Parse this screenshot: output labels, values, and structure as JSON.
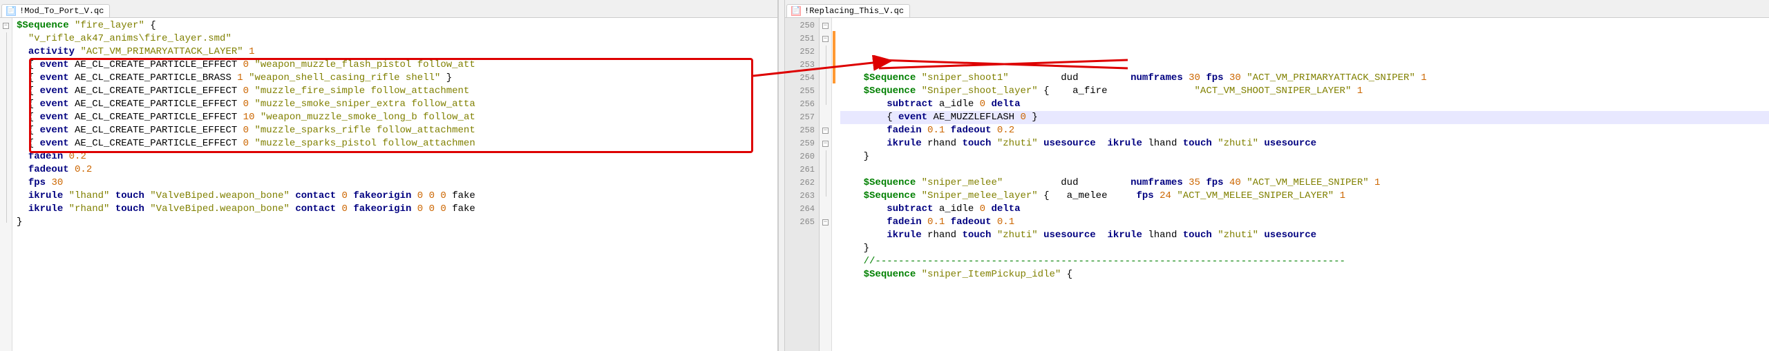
{
  "leftTab": {
    "filename": "!Mod_To_Port_V.qc"
  },
  "rightTab": {
    "filename": "!Replacing_This_V.qc"
  },
  "leftLines": [
    {
      "tokens": [
        {
          "cls": "seq",
          "t": "$Sequence"
        },
        {
          "cls": "op",
          "t": " "
        },
        {
          "cls": "str",
          "t": "\"fire_layer\""
        },
        {
          "cls": "op",
          "t": " {"
        }
      ]
    },
    {
      "tokens": [
        {
          "cls": "op",
          "t": "  "
        },
        {
          "cls": "str",
          "t": "\"v_rifle_ak47_anims\\fire_layer.smd\""
        }
      ]
    },
    {
      "tokens": [
        {
          "cls": "op",
          "t": "  "
        },
        {
          "cls": "kw-dark",
          "t": "activity"
        },
        {
          "cls": "op",
          "t": " "
        },
        {
          "cls": "str",
          "t": "\"ACT_VM_PRIMARYATTACK_LAYER\""
        },
        {
          "cls": "op",
          "t": " "
        },
        {
          "cls": "num",
          "t": "1"
        }
      ]
    },
    {
      "tokens": [
        {
          "cls": "op",
          "t": "  { "
        },
        {
          "cls": "kw-dark",
          "t": "event"
        },
        {
          "cls": "op",
          "t": " AE_CL_CREATE_PARTICLE_EFFECT "
        },
        {
          "cls": "num",
          "t": "0"
        },
        {
          "cls": "op",
          "t": " "
        },
        {
          "cls": "str",
          "t": "\"weapon_muzzle_flash_pistol follow_att"
        }
      ]
    },
    {
      "tokens": [
        {
          "cls": "op",
          "t": "  { "
        },
        {
          "cls": "kw-dark",
          "t": "event"
        },
        {
          "cls": "op",
          "t": " AE_CL_CREATE_PARTICLE_BRASS "
        },
        {
          "cls": "num",
          "t": "1"
        },
        {
          "cls": "op",
          "t": " "
        },
        {
          "cls": "str",
          "t": "\"weapon_shell_casing_rifle shell\""
        },
        {
          "cls": "op",
          "t": " }"
        }
      ]
    },
    {
      "tokens": [
        {
          "cls": "op",
          "t": "  { "
        },
        {
          "cls": "kw-dark",
          "t": "event"
        },
        {
          "cls": "op",
          "t": " AE_CL_CREATE_PARTICLE_EFFECT "
        },
        {
          "cls": "num",
          "t": "0"
        },
        {
          "cls": "op",
          "t": " "
        },
        {
          "cls": "str",
          "t": "\"muzzle_fire_simple follow_attachment"
        }
      ]
    },
    {
      "tokens": [
        {
          "cls": "op",
          "t": "  { "
        },
        {
          "cls": "kw-dark",
          "t": "event"
        },
        {
          "cls": "op",
          "t": " AE_CL_CREATE_PARTICLE_EFFECT "
        },
        {
          "cls": "num",
          "t": "0"
        },
        {
          "cls": "op",
          "t": " "
        },
        {
          "cls": "str",
          "t": "\"muzzle_smoke_sniper_extra follow_atta"
        }
      ]
    },
    {
      "tokens": [
        {
          "cls": "op",
          "t": "  { "
        },
        {
          "cls": "kw-dark",
          "t": "event"
        },
        {
          "cls": "op",
          "t": " AE_CL_CREATE_PARTICLE_EFFECT "
        },
        {
          "cls": "num",
          "t": "10"
        },
        {
          "cls": "op",
          "t": " "
        },
        {
          "cls": "str",
          "t": "\"weapon_muzzle_smoke_long_b follow_at"
        }
      ]
    },
    {
      "tokens": [
        {
          "cls": "op",
          "t": "  { "
        },
        {
          "cls": "kw-dark",
          "t": "event"
        },
        {
          "cls": "op",
          "t": " AE_CL_CREATE_PARTICLE_EFFECT "
        },
        {
          "cls": "num",
          "t": "0"
        },
        {
          "cls": "op",
          "t": " "
        },
        {
          "cls": "str",
          "t": "\"muzzle_sparks_rifle follow_attachment"
        }
      ]
    },
    {
      "tokens": [
        {
          "cls": "op",
          "t": "  { "
        },
        {
          "cls": "kw-dark",
          "t": "event"
        },
        {
          "cls": "op",
          "t": " AE_CL_CREATE_PARTICLE_EFFECT "
        },
        {
          "cls": "num",
          "t": "0"
        },
        {
          "cls": "op",
          "t": " "
        },
        {
          "cls": "str",
          "t": "\"muzzle_sparks_pistol follow_attachmen"
        }
      ]
    },
    {
      "tokens": [
        {
          "cls": "op",
          "t": "  "
        },
        {
          "cls": "kw-dark",
          "t": "fadein"
        },
        {
          "cls": "op",
          "t": " "
        },
        {
          "cls": "num",
          "t": "0.2"
        }
      ]
    },
    {
      "tokens": [
        {
          "cls": "op",
          "t": "  "
        },
        {
          "cls": "kw-dark",
          "t": "fadeout"
        },
        {
          "cls": "op",
          "t": " "
        },
        {
          "cls": "num",
          "t": "0.2"
        }
      ]
    },
    {
      "tokens": [
        {
          "cls": "op",
          "t": "  "
        },
        {
          "cls": "kw-dark",
          "t": "fps"
        },
        {
          "cls": "op",
          "t": " "
        },
        {
          "cls": "num",
          "t": "30"
        }
      ]
    },
    {
      "tokens": [
        {
          "cls": "op",
          "t": "  "
        },
        {
          "cls": "kw-dark",
          "t": "ikrule"
        },
        {
          "cls": "op",
          "t": " "
        },
        {
          "cls": "str",
          "t": "\"lhand\""
        },
        {
          "cls": "op",
          "t": " "
        },
        {
          "cls": "kw-dark",
          "t": "touch"
        },
        {
          "cls": "op",
          "t": " "
        },
        {
          "cls": "str",
          "t": "\"ValveBiped.weapon_bone\""
        },
        {
          "cls": "op",
          "t": " "
        },
        {
          "cls": "kw-dark",
          "t": "contact"
        },
        {
          "cls": "op",
          "t": " "
        },
        {
          "cls": "num",
          "t": "0"
        },
        {
          "cls": "op",
          "t": " "
        },
        {
          "cls": "kw-dark",
          "t": "fakeorigin"
        },
        {
          "cls": "op",
          "t": " "
        },
        {
          "cls": "num",
          "t": "0 0 0"
        },
        {
          "cls": "op",
          "t": " fake"
        }
      ]
    },
    {
      "tokens": [
        {
          "cls": "op",
          "t": "  "
        },
        {
          "cls": "kw-dark",
          "t": "ikrule"
        },
        {
          "cls": "op",
          "t": " "
        },
        {
          "cls": "str",
          "t": "\"rhand\""
        },
        {
          "cls": "op",
          "t": " "
        },
        {
          "cls": "kw-dark",
          "t": "touch"
        },
        {
          "cls": "op",
          "t": " "
        },
        {
          "cls": "str",
          "t": "\"ValveBiped.weapon_bone\""
        },
        {
          "cls": "op",
          "t": " "
        },
        {
          "cls": "kw-dark",
          "t": "contact"
        },
        {
          "cls": "op",
          "t": " "
        },
        {
          "cls": "num",
          "t": "0"
        },
        {
          "cls": "op",
          "t": " "
        },
        {
          "cls": "kw-dark",
          "t": "fakeorigin"
        },
        {
          "cls": "op",
          "t": " "
        },
        {
          "cls": "num",
          "t": "0 0 0"
        },
        {
          "cls": "op",
          "t": " fake"
        }
      ]
    },
    {
      "tokens": [
        {
          "cls": "op",
          "t": "}"
        }
      ]
    }
  ],
  "rightStartLine": 250,
  "rightLines": [
    {
      "hl": false,
      "fold": "box",
      "tokens": [
        {
          "cls": "op",
          "t": "    "
        },
        {
          "cls": "seq",
          "t": "$Sequence"
        },
        {
          "cls": "op",
          "t": " "
        },
        {
          "cls": "str",
          "t": "\"sniper_shoot1\""
        },
        {
          "cls": "op",
          "t": "         dud         "
        },
        {
          "cls": "kw-dark",
          "t": "numframes"
        },
        {
          "cls": "op",
          "t": " "
        },
        {
          "cls": "num",
          "t": "30"
        },
        {
          "cls": "op",
          "t": " "
        },
        {
          "cls": "kw-dark",
          "t": "fps"
        },
        {
          "cls": "op",
          "t": " "
        },
        {
          "cls": "num",
          "t": "30"
        },
        {
          "cls": "op",
          "t": " "
        },
        {
          "cls": "str",
          "t": "\"ACT_VM_PRIMARYATTACK_SNIPER\""
        },
        {
          "cls": "op",
          "t": " "
        },
        {
          "cls": "num",
          "t": "1"
        }
      ]
    },
    {
      "hl": false,
      "fold": "box",
      "change": "orange",
      "tokens": [
        {
          "cls": "op",
          "t": "    "
        },
        {
          "cls": "seq",
          "t": "$Sequence"
        },
        {
          "cls": "op",
          "t": " "
        },
        {
          "cls": "str",
          "t": "\"Sniper_shoot_layer\""
        },
        {
          "cls": "op",
          "t": " {    a_fire               "
        },
        {
          "cls": "str",
          "t": "\"ACT_VM_SHOOT_SNIPER_LAYER\""
        },
        {
          "cls": "op",
          "t": " "
        },
        {
          "cls": "num",
          "t": "1"
        }
      ]
    },
    {
      "hl": false,
      "fold": "line",
      "change": "orange",
      "tokens": [
        {
          "cls": "op",
          "t": "        "
        },
        {
          "cls": "kw-dark",
          "t": "subtract"
        },
        {
          "cls": "op",
          "t": " a_idle "
        },
        {
          "cls": "num",
          "t": "0"
        },
        {
          "cls": "op",
          "t": " "
        },
        {
          "cls": "kw-dark",
          "t": "delta"
        }
      ]
    },
    {
      "hl": true,
      "fold": "line",
      "change": "orange",
      "tokens": [
        {
          "cls": "op",
          "t": "        "
        },
        {
          "cls": "op",
          "t": "{ "
        },
        {
          "cls": "kw-dark",
          "t": "event"
        },
        {
          "cls": "op",
          "t": " AE_MUZZLEFLASH "
        },
        {
          "cls": "num",
          "t": "0"
        },
        {
          "cls": "op",
          "t": " }"
        }
      ]
    },
    {
      "hl": false,
      "fold": "line",
      "change": "orange",
      "tokens": [
        {
          "cls": "op",
          "t": "        "
        },
        {
          "cls": "kw-dark",
          "t": "fadein"
        },
        {
          "cls": "op",
          "t": " "
        },
        {
          "cls": "num",
          "t": "0.1"
        },
        {
          "cls": "op",
          "t": " "
        },
        {
          "cls": "kw-dark",
          "t": "fadeout"
        },
        {
          "cls": "op",
          "t": " "
        },
        {
          "cls": "num",
          "t": "0.2"
        }
      ]
    },
    {
      "hl": false,
      "fold": "line",
      "tokens": [
        {
          "cls": "op",
          "t": "        "
        },
        {
          "cls": "kw-dark",
          "t": "ikrule"
        },
        {
          "cls": "op",
          "t": " rhand "
        },
        {
          "cls": "kw-dark",
          "t": "touch"
        },
        {
          "cls": "op",
          "t": " "
        },
        {
          "cls": "str",
          "t": "\"zhuti\""
        },
        {
          "cls": "op",
          "t": " "
        },
        {
          "cls": "kw-dark",
          "t": "usesource"
        },
        {
          "cls": "op",
          "t": "  "
        },
        {
          "cls": "kw-dark",
          "t": "ikrule"
        },
        {
          "cls": "op",
          "t": " lhand "
        },
        {
          "cls": "kw-dark",
          "t": "touch"
        },
        {
          "cls": "op",
          "t": " "
        },
        {
          "cls": "str",
          "t": "\"zhuti\""
        },
        {
          "cls": "op",
          "t": " "
        },
        {
          "cls": "kw-dark",
          "t": "usesource"
        }
      ]
    },
    {
      "hl": false,
      "fold": "end",
      "tokens": [
        {
          "cls": "op",
          "t": "    }"
        }
      ]
    },
    {
      "hl": false,
      "tokens": []
    },
    {
      "hl": false,
      "fold": "box",
      "tokens": [
        {
          "cls": "op",
          "t": "    "
        },
        {
          "cls": "seq",
          "t": "$Sequence"
        },
        {
          "cls": "op",
          "t": " "
        },
        {
          "cls": "str",
          "t": "\"sniper_melee\""
        },
        {
          "cls": "op",
          "t": "          dud         "
        },
        {
          "cls": "kw-dark",
          "t": "numframes"
        },
        {
          "cls": "op",
          "t": " "
        },
        {
          "cls": "num",
          "t": "35"
        },
        {
          "cls": "op",
          "t": " "
        },
        {
          "cls": "kw-dark",
          "t": "fps"
        },
        {
          "cls": "op",
          "t": " "
        },
        {
          "cls": "num",
          "t": "40"
        },
        {
          "cls": "op",
          "t": " "
        },
        {
          "cls": "str",
          "t": "\"ACT_VM_MELEE_SNIPER\""
        },
        {
          "cls": "op",
          "t": " "
        },
        {
          "cls": "num",
          "t": "1"
        }
      ]
    },
    {
      "hl": false,
      "fold": "box",
      "tokens": [
        {
          "cls": "op",
          "t": "    "
        },
        {
          "cls": "seq",
          "t": "$Sequence"
        },
        {
          "cls": "op",
          "t": " "
        },
        {
          "cls": "str",
          "t": "\"Sniper_melee_layer\""
        },
        {
          "cls": "op",
          "t": " {   a_melee     "
        },
        {
          "cls": "kw-dark",
          "t": "fps"
        },
        {
          "cls": "op",
          "t": " "
        },
        {
          "cls": "num",
          "t": "24"
        },
        {
          "cls": "op",
          "t": " "
        },
        {
          "cls": "str",
          "t": "\"ACT_VM_MELEE_SNIPER_LAYER\""
        },
        {
          "cls": "op",
          "t": " "
        },
        {
          "cls": "num",
          "t": "1"
        }
      ]
    },
    {
      "hl": false,
      "fold": "line",
      "tokens": [
        {
          "cls": "op",
          "t": "        "
        },
        {
          "cls": "kw-dark",
          "t": "subtract"
        },
        {
          "cls": "op",
          "t": " a_idle "
        },
        {
          "cls": "num",
          "t": "0"
        },
        {
          "cls": "op",
          "t": " "
        },
        {
          "cls": "kw-dark",
          "t": "delta"
        }
      ]
    },
    {
      "hl": false,
      "fold": "line",
      "tokens": [
        {
          "cls": "op",
          "t": "        "
        },
        {
          "cls": "kw-dark",
          "t": "fadein"
        },
        {
          "cls": "op",
          "t": " "
        },
        {
          "cls": "num",
          "t": "0.1"
        },
        {
          "cls": "op",
          "t": " "
        },
        {
          "cls": "kw-dark",
          "t": "fadeout"
        },
        {
          "cls": "op",
          "t": " "
        },
        {
          "cls": "num",
          "t": "0.1"
        }
      ]
    },
    {
      "hl": false,
      "fold": "line",
      "tokens": [
        {
          "cls": "op",
          "t": "        "
        },
        {
          "cls": "kw-dark",
          "t": "ikrule"
        },
        {
          "cls": "op",
          "t": " rhand "
        },
        {
          "cls": "kw-dark",
          "t": "touch"
        },
        {
          "cls": "op",
          "t": " "
        },
        {
          "cls": "str",
          "t": "\"zhuti\""
        },
        {
          "cls": "op",
          "t": " "
        },
        {
          "cls": "kw-dark",
          "t": "usesource"
        },
        {
          "cls": "op",
          "t": "  "
        },
        {
          "cls": "kw-dark",
          "t": "ikrule"
        },
        {
          "cls": "op",
          "t": " lhand "
        },
        {
          "cls": "kw-dark",
          "t": "touch"
        },
        {
          "cls": "op",
          "t": " "
        },
        {
          "cls": "str",
          "t": "\"zhuti\""
        },
        {
          "cls": "op",
          "t": " "
        },
        {
          "cls": "kw-dark",
          "t": "usesource"
        }
      ]
    },
    {
      "hl": false,
      "fold": "end",
      "tokens": [
        {
          "cls": "op",
          "t": "    }"
        }
      ]
    },
    {
      "hl": false,
      "tokens": [
        {
          "cls": "op",
          "t": "    "
        },
        {
          "cls": "cmt",
          "t": "//---------------------------------------------------------------------------------"
        }
      ]
    },
    {
      "hl": false,
      "fold": "box",
      "tokens": [
        {
          "cls": "op",
          "t": "    "
        },
        {
          "cls": "seq",
          "t": "$Sequence"
        },
        {
          "cls": "op",
          "t": " "
        },
        {
          "cls": "str",
          "t": "\"sniper_ItemPickup_idle\""
        },
        {
          "cls": "op",
          "t": " {"
        }
      ]
    }
  ]
}
